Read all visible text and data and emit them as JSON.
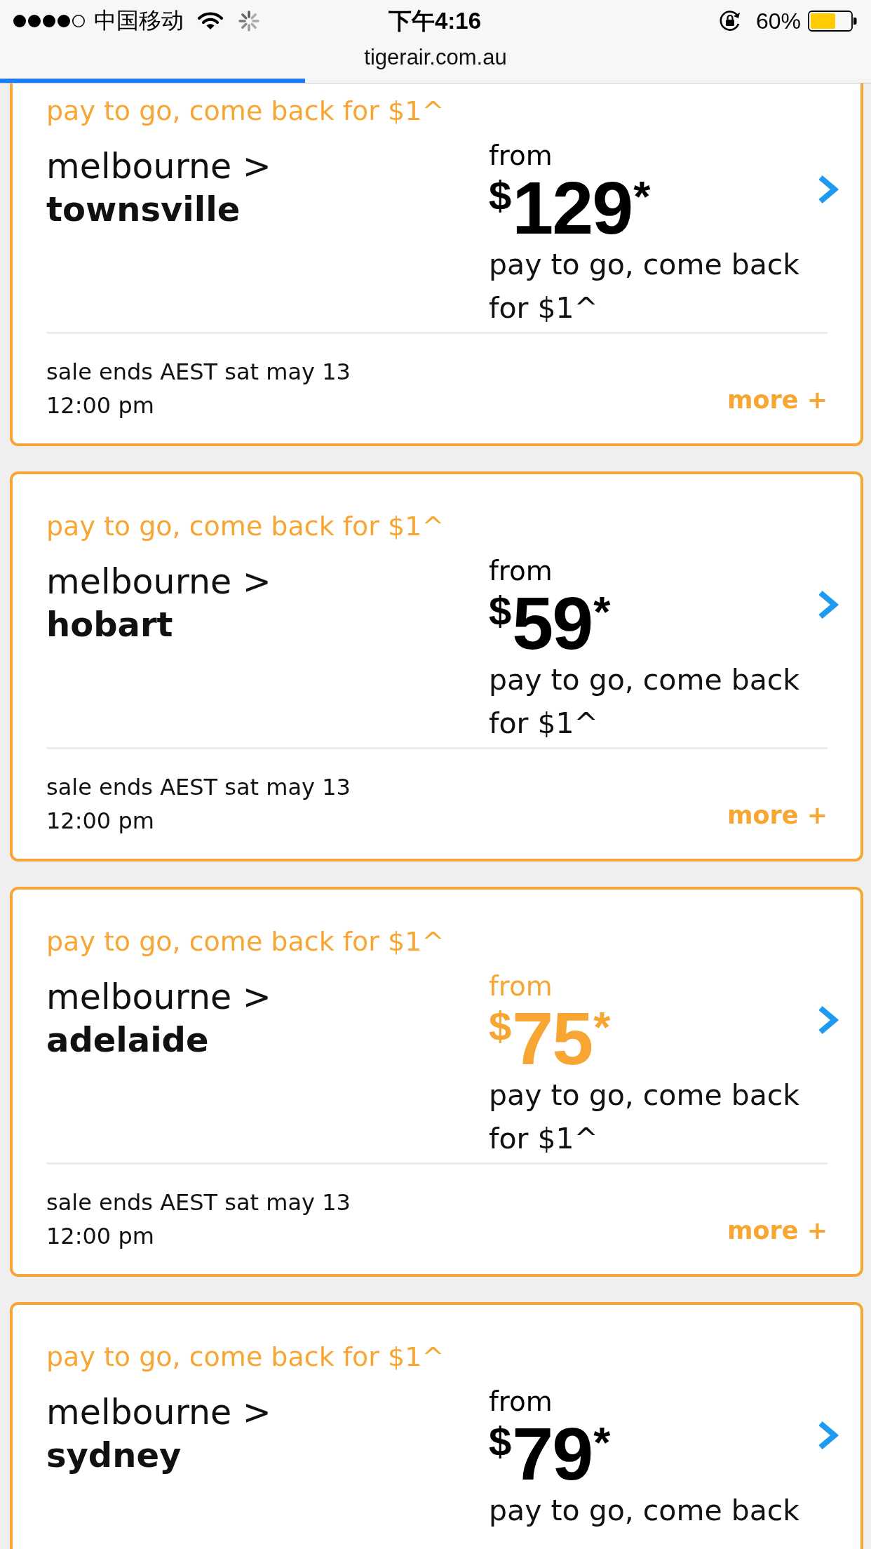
{
  "status_bar": {
    "carrier": "中国移动",
    "time": "下午4:16",
    "battery": "60%"
  },
  "address_bar": {
    "url": "tigerair.com.au",
    "loading": {
      "level": 0.35
    }
  },
  "fares": [
    {
      "promo": "pay to go, come back for $1^",
      "origin": "melbourne >",
      "destination": "townsville",
      "from_label": "from",
      "currency": "$",
      "amount": "129",
      "mark": "*",
      "highlighted": false,
      "price_note": "pay to go, come back for $1^",
      "sale_ends": "sale ends AEST sat may 13 12:00 pm",
      "more": "more +"
    },
    {
      "promo": "pay to go, come back for $1^",
      "origin": "melbourne >",
      "destination": "hobart",
      "from_label": "from",
      "currency": "$",
      "amount": "59",
      "mark": "*",
      "highlighted": false,
      "price_note": "pay to go, come back for $1^",
      "sale_ends": "sale ends AEST sat may 13 12:00 pm",
      "more": "more +"
    },
    {
      "promo": "pay to go, come back for $1^",
      "origin": "melbourne >",
      "destination": "adelaide",
      "from_label": "from",
      "currency": "$",
      "amount": "75",
      "mark": "*",
      "highlighted": true,
      "price_note": "pay to go, come back for $1^",
      "sale_ends": "sale ends AEST sat may 13 12:00 pm",
      "more": "more +"
    },
    {
      "promo": "pay to go, come back for $1^",
      "origin": "melbourne >",
      "destination": "sydney",
      "from_label": "from",
      "currency": "$",
      "amount": "79",
      "mark": "*",
      "highlighted": false,
      "price_note": "pay to go, come back"
    }
  ]
}
